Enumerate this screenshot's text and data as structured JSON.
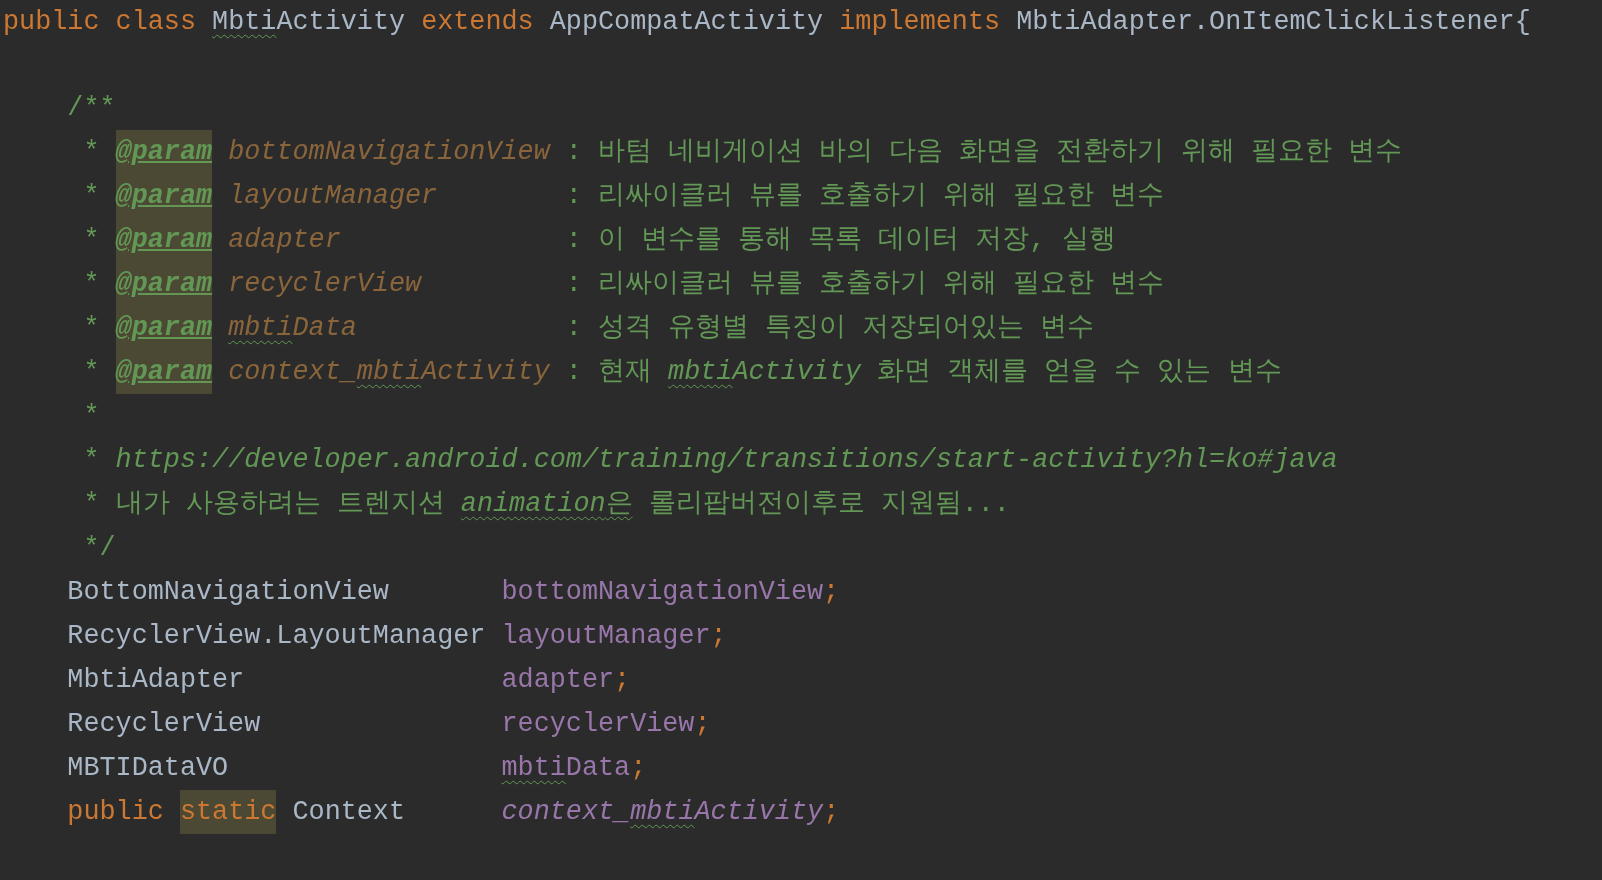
{
  "editor": {
    "lines": [
      {
        "kind": "declaration",
        "segments": [
          [
            {
              "text": "public",
              "kind": "keyword",
              "typo": false,
              "highlighted": false
            },
            {
              "text": "class",
              "kind": "keyword",
              "typo": false,
              "highlighted": false
            },
            {
              "parts": [
                {
                  "text": "Mbti",
                  "kind": "plain",
                  "typo": true
                },
                {
                  "text": "Activity",
                  "kind": "plain",
                  "typo": false
                }
              ],
              "highlighted": false
            },
            {
              "text": "extends",
              "kind": "keyword",
              "typo": false,
              "highlighted": false
            },
            {
              "text": "AppCompatActivity",
              "kind": "plain",
              "typo": false,
              "highlighted": false
            },
            {
              "text": "implements",
              "kind": "keyword",
              "typo": false,
              "highlighted": false
            },
            {
              "text": "MbtiAdapter.OnItemClickListener{",
              "kind": "plain",
              "typo": false,
              "highlighted": false
            }
          ]
        ]
      },
      {
        "kind": "doc-open",
        "segments": [
          [
            {
              "text": "/**",
              "kind": "doc",
              "typo": false,
              "highlighted": false
            }
          ]
        ]
      },
      {
        "kind": "doc-param",
        "segments": [
          [
            {
              "text": "*",
              "kind": "doc",
              "typo": false,
              "highlighted": false
            },
            {
              "text": "@param",
              "kind": "tag",
              "typo": false,
              "highlighted": true
            }
          ],
          [
            {
              "text": "bottomNavigationView",
              "kind": "param",
              "typo": false,
              "highlighted": false
            }
          ],
          [
            {
              "text": ":",
              "kind": "doc",
              "typo": false,
              "highlighted": false
            },
            {
              "text": "바텀 네비게이션 바의 다음 화면을 전환하기 위해 필요한 변수",
              "kind": "doc",
              "typo": false,
              "highlighted": false
            }
          ]
        ]
      },
      {
        "kind": "doc-param",
        "segments": [
          [
            {
              "text": "*",
              "kind": "doc",
              "typo": false,
              "highlighted": false
            },
            {
              "text": "@param",
              "kind": "tag",
              "typo": false,
              "highlighted": true
            }
          ],
          [
            {
              "text": "layoutManager",
              "kind": "param",
              "typo": false,
              "highlighted": false
            }
          ],
          [
            {
              "text": ":",
              "kind": "doc",
              "typo": false,
              "highlighted": false
            },
            {
              "text": "리싸이클러 뷰를 호출하기 위해 필요한 변수",
              "kind": "doc",
              "typo": false,
              "highlighted": false
            }
          ]
        ]
      },
      {
        "kind": "doc-param",
        "segments": [
          [
            {
              "text": "*",
              "kind": "doc",
              "typo": false,
              "highlighted": false
            },
            {
              "text": "@param",
              "kind": "tag",
              "typo": false,
              "highlighted": true
            }
          ],
          [
            {
              "text": "adapter",
              "kind": "param",
              "typo": false,
              "highlighted": false
            }
          ],
          [
            {
              "text": ":",
              "kind": "doc",
              "typo": false,
              "highlighted": false
            },
            {
              "text": "이 변수를 통해 목록 데이터 저장, 실행",
              "kind": "doc",
              "typo": false,
              "highlighted": false
            }
          ]
        ]
      },
      {
        "kind": "doc-param",
        "segments": [
          [
            {
              "text": "*",
              "kind": "doc",
              "typo": false,
              "highlighted": false
            },
            {
              "text": "@param",
              "kind": "tag",
              "typo": false,
              "highlighted": true
            }
          ],
          [
            {
              "text": "recyclerView",
              "kind": "param",
              "typo": false,
              "highlighted": false
            }
          ],
          [
            {
              "text": ":",
              "kind": "doc",
              "typo": false,
              "highlighted": false
            },
            {
              "text": "리싸이클러 뷰를 호출하기 위해 필요한 변수",
              "kind": "doc",
              "typo": false,
              "highlighted": false
            }
          ]
        ]
      },
      {
        "kind": "doc-param",
        "segments": [
          [
            {
              "text": "*",
              "kind": "doc",
              "typo": false,
              "highlighted": false
            },
            {
              "text": "@param",
              "kind": "tag",
              "typo": false,
              "highlighted": true
            }
          ],
          [
            {
              "parts": [
                {
                  "text": "mbti",
                  "kind": "param",
                  "typo": true
                },
                {
                  "text": "Data",
                  "kind": "param",
                  "typo": false
                }
              ],
              "highlighted": false
            }
          ],
          [
            {
              "text": ":",
              "kind": "doc",
              "typo": false,
              "highlighted": false
            },
            {
              "text": "성격 유형별 특징이 저장되어있는 변수",
              "kind": "doc",
              "typo": false,
              "highlighted": false
            }
          ]
        ]
      },
      {
        "kind": "doc-param",
        "segments": [
          [
            {
              "text": "*",
              "kind": "doc",
              "typo": false,
              "highlighted": false
            },
            {
              "text": "@param",
              "kind": "tag",
              "typo": false,
              "highlighted": true
            }
          ],
          [
            {
              "parts": [
                {
                  "text": "context_",
                  "kind": "param",
                  "typo": false
                },
                {
                  "text": "mbti",
                  "kind": "param",
                  "typo": true
                },
                {
                  "text": "Activity",
                  "kind": "param",
                  "typo": false
                }
              ],
              "highlighted": false
            }
          ],
          [
            {
              "text": ":",
              "kind": "doc",
              "typo": false,
              "highlighted": false
            },
            {
              "text": "현재",
              "kind": "doc",
              "typo": false,
              "highlighted": false
            },
            {
              "parts": [
                {
                  "text": "mbti",
                  "kind": "doc-italic",
                  "typo": true
                },
                {
                  "text": "Activity",
                  "kind": "doc-italic",
                  "typo": false
                }
              ],
              "highlighted": false
            },
            {
              "text": "화면 객체를 얻을 수 있는 변수",
              "kind": "doc",
              "typo": false,
              "highlighted": false
            }
          ]
        ]
      },
      {
        "kind": "doc",
        "segments": [
          [
            {
              "text": "*",
              "kind": "doc",
              "typo": false,
              "highlighted": false
            }
          ]
        ]
      },
      {
        "kind": "doc",
        "segments": [
          [
            {
              "text": "*",
              "kind": "doc",
              "typo": false,
              "highlighted": false
            },
            {
              "text": "https://developer.android.com/training/transitions/start-activity?hl=ko#java",
              "kind": "doc-italic",
              "typo": false,
              "highlighted": false
            }
          ]
        ]
      },
      {
        "kind": "doc",
        "segments": [
          [
            {
              "text": "*",
              "kind": "doc",
              "typo": false,
              "highlighted": false
            },
            {
              "text": "내가 사용하려는 트렌지션",
              "kind": "doc",
              "typo": false,
              "highlighted": false
            },
            {
              "parts": [
                {
                  "text": "animation",
                  "kind": "doc-italic",
                  "typo": true
                },
                {
                  "text": "은",
                  "kind": "doc",
                  "typo": true
                }
              ],
              "highlighted": false
            },
            {
              "text": "롤리팝버전이후로 지원됨...",
              "kind": "doc",
              "typo": false,
              "highlighted": false
            }
          ]
        ]
      },
      {
        "kind": "doc",
        "segments": [
          [
            {
              "text": "*/",
              "kind": "doc",
              "typo": false,
              "highlighted": false
            }
          ]
        ]
      },
      {
        "kind": "field",
        "segments": [
          [
            {
              "text": "BottomNavigationView",
              "kind": "plain",
              "typo": false,
              "highlighted": false
            }
          ],
          [
            {
              "parts": [
                {
                  "text": "bottomNavigationView",
                  "kind": "field",
                  "typo": false
                },
                {
                  "text": ";",
                  "kind": "punct",
                  "typo": false
                }
              ],
              "highlighted": false
            }
          ]
        ]
      },
      {
        "kind": "field",
        "segments": [
          [
            {
              "text": "RecyclerView.LayoutManager",
              "kind": "plain",
              "typo": false,
              "highlighted": false
            }
          ],
          [
            {
              "parts": [
                {
                  "text": "layoutManager",
                  "kind": "field",
                  "typo": false
                },
                {
                  "text": ";",
                  "kind": "punct",
                  "typo": false
                }
              ],
              "highlighted": false
            }
          ]
        ]
      },
      {
        "kind": "field",
        "segments": [
          [
            {
              "text": "MbtiAdapter",
              "kind": "plain",
              "typo": false,
              "highlighted": false
            }
          ],
          [
            {
              "parts": [
                {
                  "text": "adapter",
                  "kind": "field",
                  "typo": false
                },
                {
                  "text": ";",
                  "kind": "punct",
                  "typo": false
                }
              ],
              "highlighted": false
            }
          ]
        ]
      },
      {
        "kind": "field",
        "segments": [
          [
            {
              "text": "RecyclerView",
              "kind": "plain",
              "typo": false,
              "highlighted": false
            }
          ],
          [
            {
              "parts": [
                {
                  "text": "recyclerView",
                  "kind": "field",
                  "typo": false
                },
                {
                  "text": ";",
                  "kind": "punct",
                  "typo": false
                }
              ],
              "highlighted": false
            }
          ]
        ]
      },
      {
        "kind": "field",
        "segments": [
          [
            {
              "text": "MBTIDataVO",
              "kind": "plain",
              "typo": false,
              "highlighted": false
            }
          ],
          [
            {
              "parts": [
                {
                  "text": "mbti",
                  "kind": "field",
                  "typo": true
                },
                {
                  "text": "Data",
                  "kind": "field",
                  "typo": false
                },
                {
                  "text": ";",
                  "kind": "punct",
                  "typo": false
                }
              ],
              "highlighted": false
            }
          ]
        ]
      },
      {
        "kind": "field",
        "segments": [
          [
            {
              "text": "public",
              "kind": "keyword",
              "typo": false,
              "highlighted": false
            },
            {
              "text": "static",
              "kind": "keyword",
              "typo": false,
              "highlighted": true
            },
            {
              "text": "Context",
              "kind": "plain",
              "typo": false,
              "highlighted": false
            }
          ],
          [
            {
              "parts": [
                {
                  "text": "context_",
                  "kind": "field-italic",
                  "typo": false
                },
                {
                  "text": "mbti",
                  "kind": "field-italic",
                  "typo": true
                },
                {
                  "text": "Activity",
                  "kind": "field-italic",
                  "typo": false
                },
                {
                  "text": ";",
                  "kind": "punct",
                  "typo": false
                }
              ],
              "highlighted": false
            }
          ]
        ]
      }
    ]
  }
}
